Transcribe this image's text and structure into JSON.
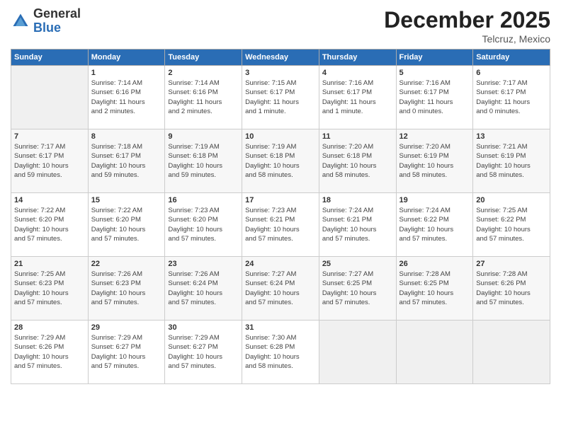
{
  "logo": {
    "general": "General",
    "blue": "Blue"
  },
  "title": "December 2025",
  "location": "Telcruz, Mexico",
  "days_of_week": [
    "Sunday",
    "Monday",
    "Tuesday",
    "Wednesday",
    "Thursday",
    "Friday",
    "Saturday"
  ],
  "weeks": [
    [
      {
        "num": "",
        "info": ""
      },
      {
        "num": "1",
        "info": "Sunrise: 7:14 AM\nSunset: 6:16 PM\nDaylight: 11 hours\nand 2 minutes."
      },
      {
        "num": "2",
        "info": "Sunrise: 7:14 AM\nSunset: 6:16 PM\nDaylight: 11 hours\nand 2 minutes."
      },
      {
        "num": "3",
        "info": "Sunrise: 7:15 AM\nSunset: 6:17 PM\nDaylight: 11 hours\nand 1 minute."
      },
      {
        "num": "4",
        "info": "Sunrise: 7:16 AM\nSunset: 6:17 PM\nDaylight: 11 hours\nand 1 minute."
      },
      {
        "num": "5",
        "info": "Sunrise: 7:16 AM\nSunset: 6:17 PM\nDaylight: 11 hours\nand 0 minutes."
      },
      {
        "num": "6",
        "info": "Sunrise: 7:17 AM\nSunset: 6:17 PM\nDaylight: 11 hours\nand 0 minutes."
      }
    ],
    [
      {
        "num": "7",
        "info": "Sunrise: 7:17 AM\nSunset: 6:17 PM\nDaylight: 10 hours\nand 59 minutes."
      },
      {
        "num": "8",
        "info": "Sunrise: 7:18 AM\nSunset: 6:17 PM\nDaylight: 10 hours\nand 59 minutes."
      },
      {
        "num": "9",
        "info": "Sunrise: 7:19 AM\nSunset: 6:18 PM\nDaylight: 10 hours\nand 59 minutes."
      },
      {
        "num": "10",
        "info": "Sunrise: 7:19 AM\nSunset: 6:18 PM\nDaylight: 10 hours\nand 58 minutes."
      },
      {
        "num": "11",
        "info": "Sunrise: 7:20 AM\nSunset: 6:18 PM\nDaylight: 10 hours\nand 58 minutes."
      },
      {
        "num": "12",
        "info": "Sunrise: 7:20 AM\nSunset: 6:19 PM\nDaylight: 10 hours\nand 58 minutes."
      },
      {
        "num": "13",
        "info": "Sunrise: 7:21 AM\nSunset: 6:19 PM\nDaylight: 10 hours\nand 58 minutes."
      }
    ],
    [
      {
        "num": "14",
        "info": "Sunrise: 7:22 AM\nSunset: 6:20 PM\nDaylight: 10 hours\nand 57 minutes."
      },
      {
        "num": "15",
        "info": "Sunrise: 7:22 AM\nSunset: 6:20 PM\nDaylight: 10 hours\nand 57 minutes."
      },
      {
        "num": "16",
        "info": "Sunrise: 7:23 AM\nSunset: 6:20 PM\nDaylight: 10 hours\nand 57 minutes."
      },
      {
        "num": "17",
        "info": "Sunrise: 7:23 AM\nSunset: 6:21 PM\nDaylight: 10 hours\nand 57 minutes."
      },
      {
        "num": "18",
        "info": "Sunrise: 7:24 AM\nSunset: 6:21 PM\nDaylight: 10 hours\nand 57 minutes."
      },
      {
        "num": "19",
        "info": "Sunrise: 7:24 AM\nSunset: 6:22 PM\nDaylight: 10 hours\nand 57 minutes."
      },
      {
        "num": "20",
        "info": "Sunrise: 7:25 AM\nSunset: 6:22 PM\nDaylight: 10 hours\nand 57 minutes."
      }
    ],
    [
      {
        "num": "21",
        "info": "Sunrise: 7:25 AM\nSunset: 6:23 PM\nDaylight: 10 hours\nand 57 minutes."
      },
      {
        "num": "22",
        "info": "Sunrise: 7:26 AM\nSunset: 6:23 PM\nDaylight: 10 hours\nand 57 minutes."
      },
      {
        "num": "23",
        "info": "Sunrise: 7:26 AM\nSunset: 6:24 PM\nDaylight: 10 hours\nand 57 minutes."
      },
      {
        "num": "24",
        "info": "Sunrise: 7:27 AM\nSunset: 6:24 PM\nDaylight: 10 hours\nand 57 minutes."
      },
      {
        "num": "25",
        "info": "Sunrise: 7:27 AM\nSunset: 6:25 PM\nDaylight: 10 hours\nand 57 minutes."
      },
      {
        "num": "26",
        "info": "Sunrise: 7:28 AM\nSunset: 6:25 PM\nDaylight: 10 hours\nand 57 minutes."
      },
      {
        "num": "27",
        "info": "Sunrise: 7:28 AM\nSunset: 6:26 PM\nDaylight: 10 hours\nand 57 minutes."
      }
    ],
    [
      {
        "num": "28",
        "info": "Sunrise: 7:29 AM\nSunset: 6:26 PM\nDaylight: 10 hours\nand 57 minutes."
      },
      {
        "num": "29",
        "info": "Sunrise: 7:29 AM\nSunset: 6:27 PM\nDaylight: 10 hours\nand 57 minutes."
      },
      {
        "num": "30",
        "info": "Sunrise: 7:29 AM\nSunset: 6:27 PM\nDaylight: 10 hours\nand 57 minutes."
      },
      {
        "num": "31",
        "info": "Sunrise: 7:30 AM\nSunset: 6:28 PM\nDaylight: 10 hours\nand 58 minutes."
      },
      {
        "num": "",
        "info": ""
      },
      {
        "num": "",
        "info": ""
      },
      {
        "num": "",
        "info": ""
      }
    ]
  ]
}
